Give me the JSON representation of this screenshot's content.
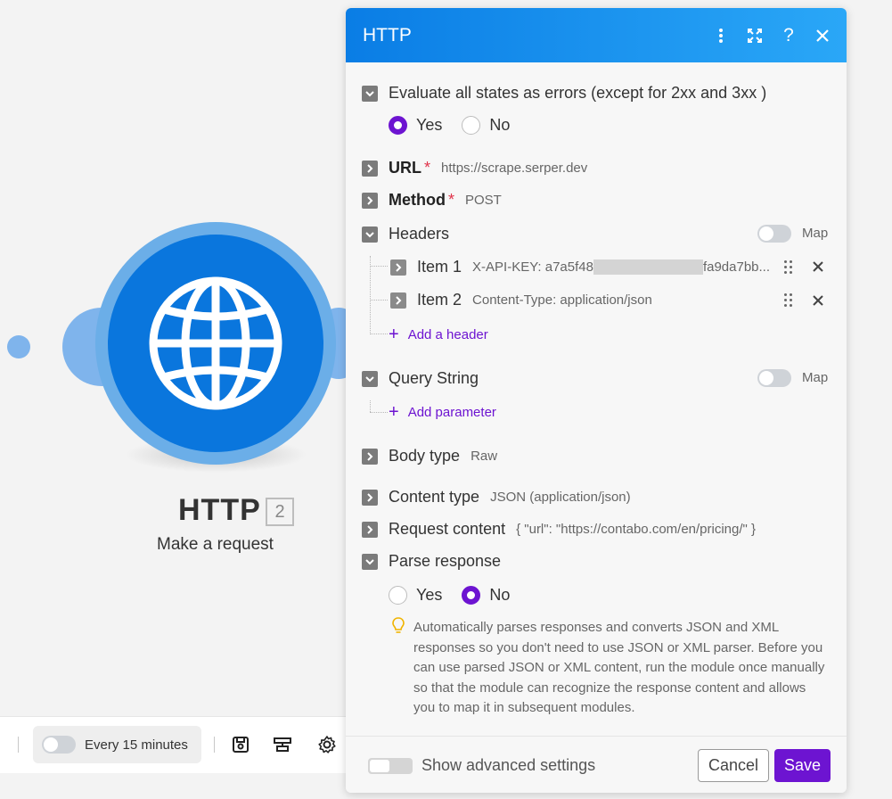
{
  "node": {
    "title": "HTTP",
    "badge": "2",
    "subtitle": "Make a request",
    "icon": "globe-icon"
  },
  "toolbar": {
    "schedule_label": "Every 15 minutes",
    "icons": [
      "save-icon",
      "align-icon",
      "gear-icon"
    ]
  },
  "panel": {
    "title": "HTTP",
    "header_icons": [
      "more-vertical-icon",
      "expand-icon",
      "help-icon",
      "close-icon"
    ],
    "evaluate_errors": {
      "label": "Evaluate all states as errors (except for 2xx and 3xx )",
      "options": [
        "Yes",
        "No"
      ],
      "selected": "Yes"
    },
    "url": {
      "label": "URL",
      "required_mark": "*",
      "value": "https://scrape.serper.dev"
    },
    "method": {
      "label": "Method",
      "required_mark": "*",
      "value": "POST"
    },
    "headers": {
      "label": "Headers",
      "map_label": "Map",
      "items": [
        {
          "label": "Item 1",
          "value_prefix": "X-API-KEY: a7a5f48",
          "value_suffix": "fa9da7bb..."
        },
        {
          "label": "Item 2",
          "value": "Content-Type: application/json"
        }
      ],
      "add_label": "Add a header"
    },
    "query_string": {
      "label": "Query String",
      "map_label": "Map",
      "add_label": "Add parameter"
    },
    "body_type": {
      "label": "Body type",
      "value": "Raw"
    },
    "content_type": {
      "label": "Content type",
      "value": "JSON (application/json)"
    },
    "request_content": {
      "label": "Request content",
      "value": "{ \"url\": \"https://contabo.com/en/pricing/\" }"
    },
    "parse_response": {
      "label": "Parse response",
      "options": [
        "Yes",
        "No"
      ],
      "selected": "No",
      "hint": "Automatically parses responses and converts JSON and XML responses so you don't need to use JSON or XML parser. Before you can use parsed JSON or XML content, run the module once manually so that the module can recognize the response content and allows you to map it in subsequent modules."
    },
    "footer": {
      "advanced_label": "Show advanced settings",
      "cancel_label": "Cancel",
      "save_label": "Save"
    }
  }
}
